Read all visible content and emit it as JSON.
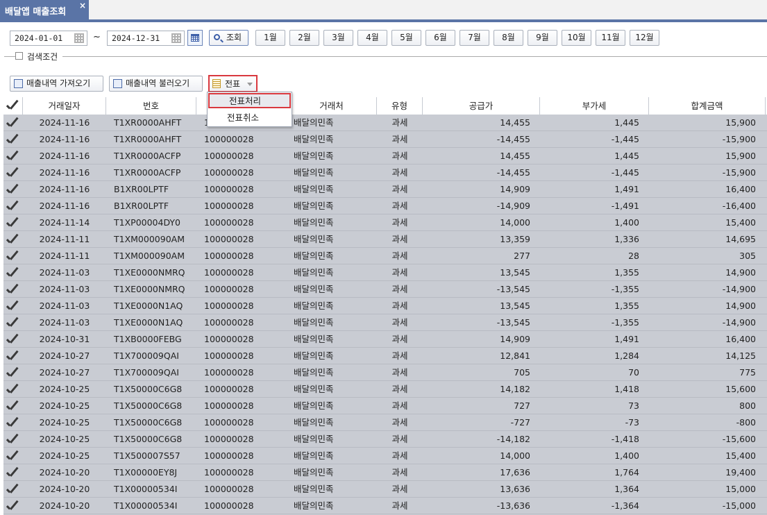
{
  "tab": {
    "title": "배달앱 매출조회",
    "close": "×"
  },
  "filters": {
    "date_from": "2024-01-01",
    "tilde": "~",
    "date_to": "2024-12-31",
    "search_label": "조회",
    "months": [
      "1월",
      "2월",
      "3월",
      "4월",
      "5월",
      "6월",
      "7월",
      "8월",
      "9월",
      "10월",
      "11월",
      "12월"
    ],
    "condition_label": "검색조건"
  },
  "actions": {
    "fetch_sales": "매출내역 가져오기",
    "load_sales": "매출내역 불러오기",
    "voucher": "전표"
  },
  "voucher_menu": {
    "items": [
      "전표처리",
      "전표취소"
    ]
  },
  "grid": {
    "columns": [
      "거래일자",
      "번호",
      "",
      "거래처",
      "유형",
      "공급가",
      "부가세",
      "합계금액"
    ],
    "rows": [
      {
        "date": "2024-11-16",
        "no": "T1XR0000AHFT",
        "code": "100000028",
        "client": "배달의민족",
        "type": "과세",
        "supply": "14,455",
        "vat": "1,445",
        "total": "15,900"
      },
      {
        "date": "2024-11-16",
        "no": "T1XR0000AHFT",
        "code": "100000028",
        "client": "배달의민족",
        "type": "과세",
        "supply": "-14,455",
        "vat": "-1,445",
        "total": "-15,900"
      },
      {
        "date": "2024-11-16",
        "no": "T1XR0000ACFP",
        "code": "100000028",
        "client": "배달의민족",
        "type": "과세",
        "supply": "14,455",
        "vat": "1,445",
        "total": "15,900"
      },
      {
        "date": "2024-11-16",
        "no": "T1XR0000ACFP",
        "code": "100000028",
        "client": "배달의민족",
        "type": "과세",
        "supply": "-14,455",
        "vat": "-1,445",
        "total": "-15,900"
      },
      {
        "date": "2024-11-16",
        "no": "B1XR00LPTF",
        "code": "100000028",
        "client": "배달의민족",
        "type": "과세",
        "supply": "14,909",
        "vat": "1,491",
        "total": "16,400"
      },
      {
        "date": "2024-11-16",
        "no": "B1XR00LPTF",
        "code": "100000028",
        "client": "배달의민족",
        "type": "과세",
        "supply": "-14,909",
        "vat": "-1,491",
        "total": "-16,400"
      },
      {
        "date": "2024-11-14",
        "no": "T1XP00004DY0",
        "code": "100000028",
        "client": "배달의민족",
        "type": "과세",
        "supply": "14,000",
        "vat": "1,400",
        "total": "15,400"
      },
      {
        "date": "2024-11-11",
        "no": "T1XM000090AM",
        "code": "100000028",
        "client": "배달의민족",
        "type": "과세",
        "supply": "13,359",
        "vat": "1,336",
        "total": "14,695"
      },
      {
        "date": "2024-11-11",
        "no": "T1XM000090AM",
        "code": "100000028",
        "client": "배달의민족",
        "type": "과세",
        "supply": "277",
        "vat": "28",
        "total": "305"
      },
      {
        "date": "2024-11-03",
        "no": "T1XE0000NMRQ",
        "code": "100000028",
        "client": "배달의민족",
        "type": "과세",
        "supply": "13,545",
        "vat": "1,355",
        "total": "14,900"
      },
      {
        "date": "2024-11-03",
        "no": "T1XE0000NMRQ",
        "code": "100000028",
        "client": "배달의민족",
        "type": "과세",
        "supply": "-13,545",
        "vat": "-1,355",
        "total": "-14,900"
      },
      {
        "date": "2024-11-03",
        "no": "T1XE0000N1AQ",
        "code": "100000028",
        "client": "배달의민족",
        "type": "과세",
        "supply": "13,545",
        "vat": "1,355",
        "total": "14,900"
      },
      {
        "date": "2024-11-03",
        "no": "T1XE0000N1AQ",
        "code": "100000028",
        "client": "배달의민족",
        "type": "과세",
        "supply": "-13,545",
        "vat": "-1,355",
        "total": "-14,900"
      },
      {
        "date": "2024-10-31",
        "no": "T1XB0000FEBG",
        "code": "100000028",
        "client": "배달의민족",
        "type": "과세",
        "supply": "14,909",
        "vat": "1,491",
        "total": "16,400"
      },
      {
        "date": "2024-10-27",
        "no": "T1X700009QAI",
        "code": "100000028",
        "client": "배달의민족",
        "type": "과세",
        "supply": "12,841",
        "vat": "1,284",
        "total": "14,125"
      },
      {
        "date": "2024-10-27",
        "no": "T1X700009QAI",
        "code": "100000028",
        "client": "배달의민족",
        "type": "과세",
        "supply": "705",
        "vat": "70",
        "total": "775"
      },
      {
        "date": "2024-10-25",
        "no": "T1X50000C6G8",
        "code": "100000028",
        "client": "배달의민족",
        "type": "과세",
        "supply": "14,182",
        "vat": "1,418",
        "total": "15,600"
      },
      {
        "date": "2024-10-25",
        "no": "T1X50000C6G8",
        "code": "100000028",
        "client": "배달의민족",
        "type": "과세",
        "supply": "727",
        "vat": "73",
        "total": "800"
      },
      {
        "date": "2024-10-25",
        "no": "T1X50000C6G8",
        "code": "100000028",
        "client": "배달의민족",
        "type": "과세",
        "supply": "-727",
        "vat": "-73",
        "total": "-800"
      },
      {
        "date": "2024-10-25",
        "no": "T1X50000C6G8",
        "code": "100000028",
        "client": "배달의민족",
        "type": "과세",
        "supply": "-14,182",
        "vat": "-1,418",
        "total": "-15,600"
      },
      {
        "date": "2024-10-25",
        "no": "T1X500007S57",
        "code": "100000028",
        "client": "배달의민족",
        "type": "과세",
        "supply": "14,000",
        "vat": "1,400",
        "total": "15,400"
      },
      {
        "date": "2024-10-20",
        "no": "T1X00000EY8J",
        "code": "100000028",
        "client": "배달의민족",
        "type": "과세",
        "supply": "17,636",
        "vat": "1,764",
        "total": "19,400"
      },
      {
        "date": "2024-10-20",
        "no": "T1X00000534I",
        "code": "100000028",
        "client": "배달의민족",
        "type": "과세",
        "supply": "13,636",
        "vat": "1,364",
        "total": "15,000"
      },
      {
        "date": "2024-10-20",
        "no": "T1X00000534I",
        "code": "100000028",
        "client": "배달의민족",
        "type": "과세",
        "supply": "-13,636",
        "vat": "-1,364",
        "total": "-15,000"
      }
    ]
  },
  "colors": {
    "tab_bg": "#5a74a6",
    "row_bg": "#c9ccd3",
    "highlight": "#d9383e"
  }
}
